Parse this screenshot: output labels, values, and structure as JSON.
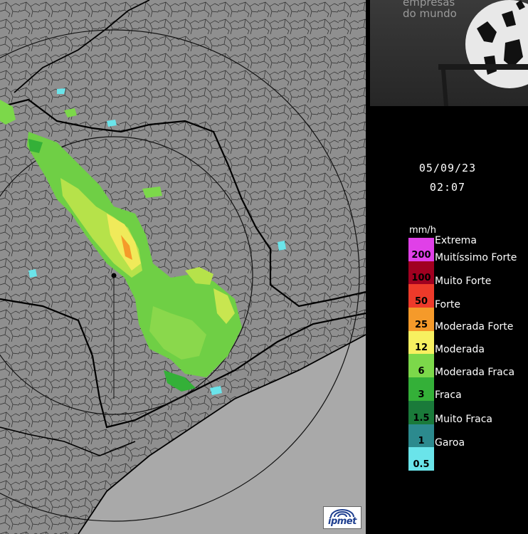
{
  "map": {
    "logo_text": "ipmet"
  },
  "ad": {
    "line1": "empresas",
    "line2": "do mundo"
  },
  "timestamp": {
    "date": "05/09/23",
    "time": "02:07"
  },
  "legend": {
    "unit": "mm/h",
    "values": [
      "200",
      "100",
      "50",
      "25",
      "12",
      "6",
      "3",
      "1.5",
      "1",
      "0.5"
    ],
    "colors": [
      "#e040e8",
      "#a00020",
      "#ee3a2a",
      "#f59a2a",
      "#f7f060",
      "#7cd84a",
      "#34b038",
      "#1a7a3a",
      "#2c8a8e",
      "#6ae4ea"
    ],
    "categories": [
      "Extrema",
      "Muitíssimo Forte",
      "Muito Forte",
      "Forte",
      "Moderada Forte",
      "Moderada",
      "Moderada Fraca",
      "Fraca",
      "Muito Fraca",
      "Garoa"
    ]
  }
}
